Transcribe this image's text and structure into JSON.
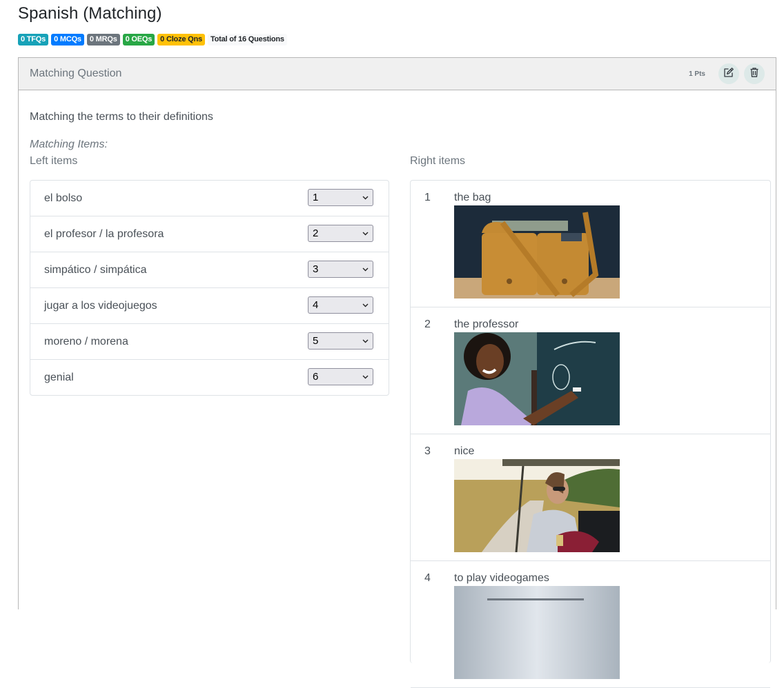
{
  "page": {
    "title": "Spanish (Matching)",
    "badges": [
      {
        "label": "0 TFQs",
        "variant": "info",
        "color": "#17a2b8"
      },
      {
        "label": "0 MCQs",
        "variant": "primary",
        "color": "#007bff"
      },
      {
        "label": "0 MRQs",
        "variant": "secondary",
        "color": "#6c757d"
      },
      {
        "label": "0 OEQs",
        "variant": "success",
        "color": "#28a745"
      },
      {
        "label": "0 Cloze Qns",
        "variant": "warning",
        "color": "#ffc107"
      },
      {
        "label": "Total of 16 Questions",
        "variant": "light",
        "color": "#f8f9fa"
      }
    ]
  },
  "question": {
    "header_title": "Matching Question",
    "points": "1 Pts",
    "actions": [
      {
        "name": "edit",
        "icon": "pencil-square-icon"
      },
      {
        "name": "delete",
        "icon": "trash-icon"
      }
    ],
    "description": "Matching the terms to their definitions",
    "items_label": "Matching Items:",
    "left_label": "Left items",
    "right_label": "Right items",
    "left_items": [
      {
        "term": "el bolso",
        "selected": "1"
      },
      {
        "term": "el profesor / la profesora",
        "selected": "2"
      },
      {
        "term": "simpático / simpática",
        "selected": "3"
      },
      {
        "term": "jugar a los videojuegos",
        "selected": "4"
      },
      {
        "term": "moreno / morena",
        "selected": "5"
      },
      {
        "term": "genial",
        "selected": "6"
      }
    ],
    "right_items": [
      {
        "number": "1",
        "text": "the bag",
        "image": "photo of a tan leather shoulder bag"
      },
      {
        "number": "2",
        "text": "the professor",
        "image": "photo of a smiling teacher writing on a chalkboard"
      },
      {
        "number": "3",
        "text": "nice",
        "image": "photo of a woman in sunglasses riding in an open vehicle"
      },
      {
        "number": "4",
        "text": "to play videogames",
        "image": "photo (partially visible)"
      }
    ]
  }
}
